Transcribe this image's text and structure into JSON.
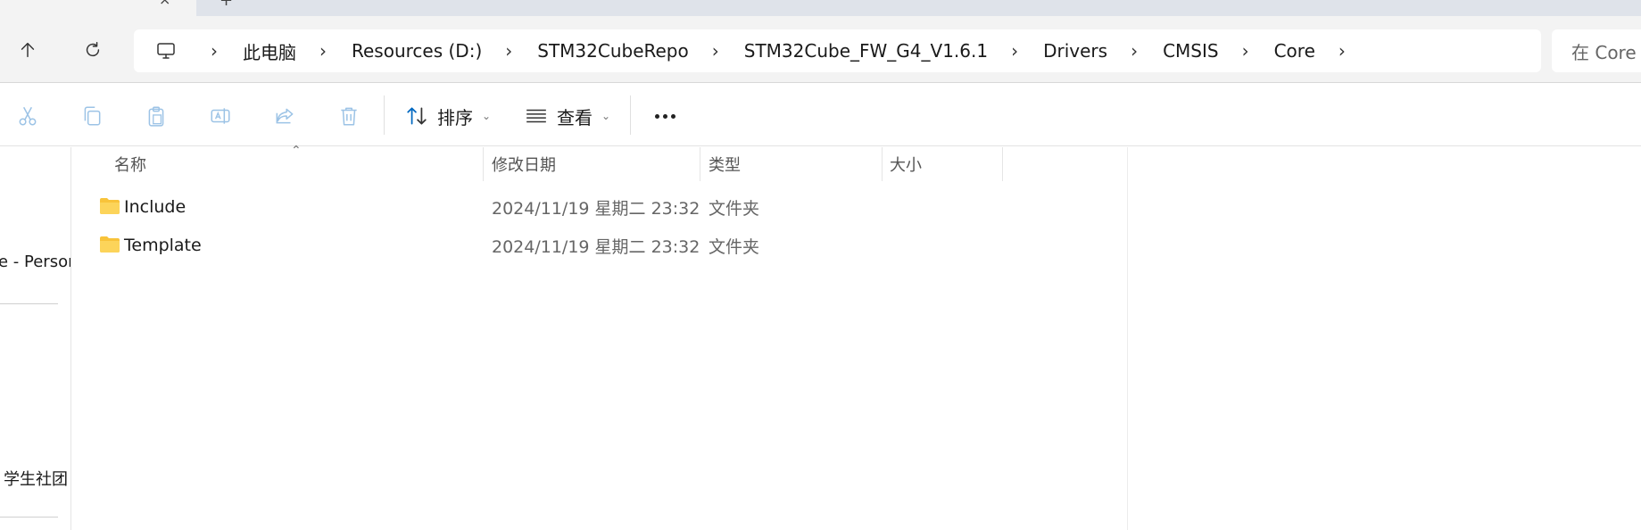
{
  "address": {
    "crumbs": [
      "此电脑",
      "Resources (D:)",
      "STM32CubeRepo",
      "STM32Cube_FW_G4_V1.6.1",
      "Drivers",
      "CMSIS",
      "Core"
    ],
    "search_placeholder": "在 Core"
  },
  "toolbar": {
    "sort_label": "排序",
    "view_label": "查看"
  },
  "nav": {
    "items": [
      "e - Person",
      "学生社团"
    ]
  },
  "columns": {
    "name": "名称",
    "date": "修改日期",
    "type": "类型",
    "size": "大小"
  },
  "files": [
    {
      "name": "Include",
      "date": "2024/11/19 星期二 23:32",
      "type": "文件夹"
    },
    {
      "name": "Template",
      "date": "2024/11/19 星期二 23:32",
      "type": "文件夹"
    }
  ],
  "colors": {
    "accent": "#0067c0",
    "folder": "#f8c33a",
    "disabled_icon": "#9cc3e6"
  }
}
